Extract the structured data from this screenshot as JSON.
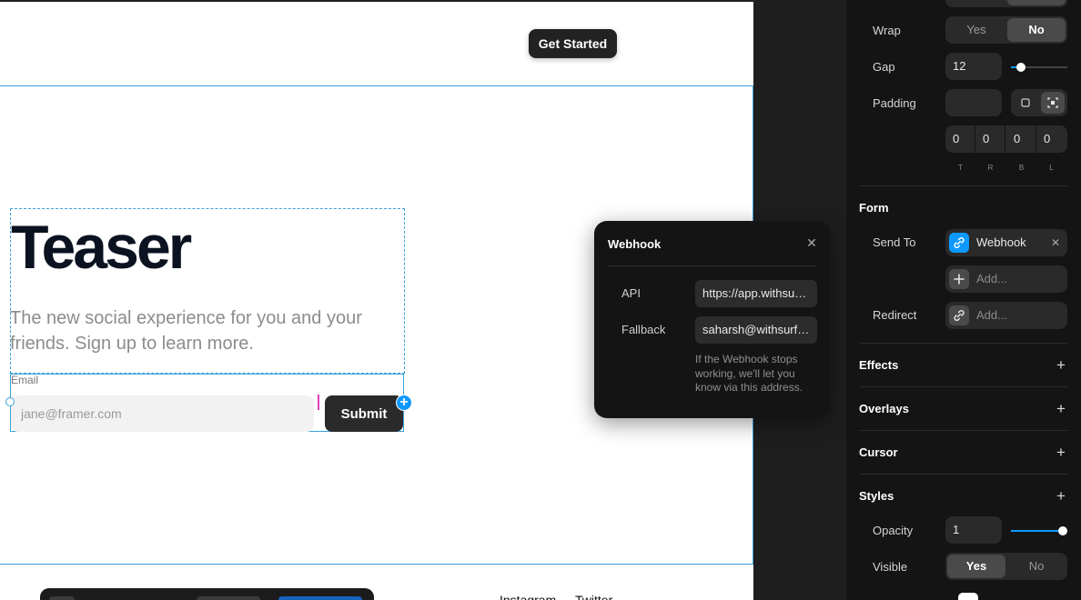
{
  "canvas": {
    "cta_label": "Get Started",
    "hero_title": "Teaser",
    "hero_subtitle": "The new social experience for you and your friends. Sign up to learn more.",
    "email_label": "Email",
    "email_placeholder": "jane@framer.com",
    "submit_label": "Submit",
    "footer_links": [
      "Instagram",
      "Twitter"
    ]
  },
  "webhook": {
    "title": "Webhook",
    "api_label": "API",
    "api_value": "https://app.withsurf.com/api/webhook",
    "fallback_label": "Fallback",
    "fallback_value": "saharsh@withsurf.com",
    "hint": "If the Webhook stops working, we'll let you know via this address."
  },
  "panel": {
    "wrap": {
      "label": "Wrap",
      "options": [
        "Yes",
        "No"
      ],
      "selected": "No"
    },
    "gap": {
      "label": "Gap",
      "value": "12"
    },
    "padding": {
      "label": "Padding",
      "values": [
        "0",
        "0",
        "0",
        "0"
      ],
      "sides": [
        "T",
        "R",
        "B",
        "L"
      ]
    },
    "form": {
      "title": "Form",
      "send_to_label": "Send To",
      "send_to_value": "Webhook",
      "add_placeholder": "Add...",
      "redirect_label": "Redirect",
      "redirect_placeholder": "Add..."
    },
    "sections": [
      "Effects",
      "Overlays",
      "Cursor",
      "Styles"
    ],
    "opacity": {
      "label": "Opacity",
      "value": "1",
      "level": 1
    },
    "visible": {
      "label": "Visible",
      "options": [
        "Yes",
        "No"
      ],
      "selected": "Yes"
    }
  },
  "colors": {
    "accent": "#0d99ff",
    "panel_bg": "#141414",
    "selection": "#3aa0d8"
  }
}
